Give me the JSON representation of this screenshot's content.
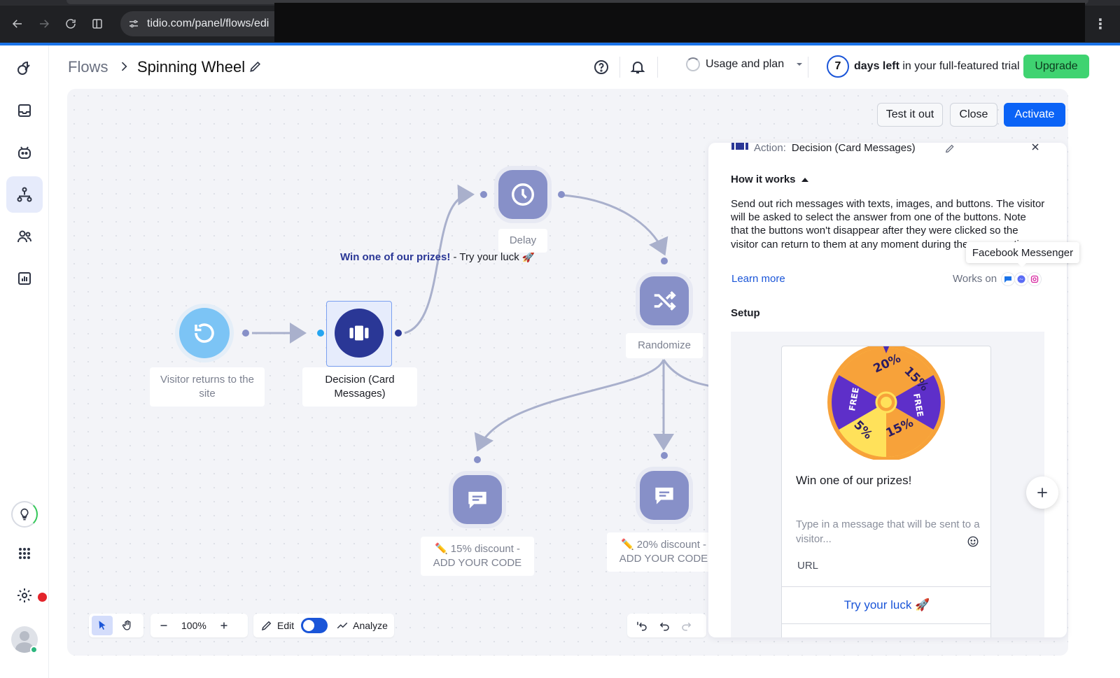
{
  "browser": {
    "url": "tidio.com/panel/flows/edi",
    "icons": [
      "back-arrow-icon",
      "forward-arrow-icon",
      "reload-icon",
      "split-view-icon",
      "site-settings-icon",
      "more-vertical-icon"
    ]
  },
  "sidebar": {
    "items": [
      {
        "name": "dashboard",
        "icon": "dashboard-icon"
      },
      {
        "name": "inbox",
        "icon": "inbox-icon"
      },
      {
        "name": "ai-agent",
        "icon": "bot-icon"
      },
      {
        "name": "flows",
        "icon": "flows-icon",
        "active": true
      },
      {
        "name": "contacts",
        "icon": "contacts-icon"
      },
      {
        "name": "analytics",
        "icon": "analytics-icon"
      }
    ],
    "bottom": [
      "lightbulb-icon",
      "apps-grid-icon",
      "settings-icon",
      "avatar"
    ]
  },
  "header": {
    "breadcrumb_root": "Flows",
    "title": "Spinning Wheel",
    "usage_label": "Usage and plan",
    "trial_days": "7",
    "trial_bold": "days left",
    "trial_rest": " in your full-featured trial",
    "upgrade_label": "Upgrade"
  },
  "actions": {
    "test": "Test it out",
    "close": "Close",
    "activate": "Activate"
  },
  "flow": {
    "nodes": {
      "trigger": "Visitor returns to the site",
      "decision": "Decision (Card Messages)",
      "delay": "Delay",
      "randomize": "Randomize",
      "msg1": "✏️ 15% discount - ADD YOUR CODE",
      "msg2": "✏️ 20% discount - ADD YOUR CODE"
    },
    "edge_label_bold": "Win one of our prizes!",
    "edge_label_rest": " - Try your luck 🚀"
  },
  "toolbar": {
    "zoom": "100%",
    "edit_label": "Edit",
    "analyze_label": "Analyze"
  },
  "panel": {
    "action_prefix": "Action:",
    "action_name": "Decision (Card Messages)",
    "how_title": "How it works",
    "how_body": "Send out rich messages with texts, images, and buttons. The visitor will be asked to select the answer from one of the buttons. Note that the buttons won't disappear after they were clicked so the visitor can return to them at any moment during the conversation.",
    "learn_more": "Learn more",
    "works_on": "Works on",
    "tooltip": "Facebook Messenger",
    "setup_title": "Setup",
    "card": {
      "title": "Win one of our prizes!",
      "message_placeholder": "Type in a message that will be sent to a visitor...",
      "url_label": "URL",
      "button_label": "Try your luck 🚀"
    },
    "wheel_segments": [
      "20% OFF",
      "15% OFF",
      "FREE DELIVERY",
      "15% OFF",
      "5% OFF",
      "FREE DELIVERY"
    ]
  },
  "colors": {
    "primary": "#0b63f6",
    "upgrade": "#3fd371",
    "node": "#8790c8",
    "decision": "#2a3796",
    "trigger": "#7cc4f5"
  }
}
